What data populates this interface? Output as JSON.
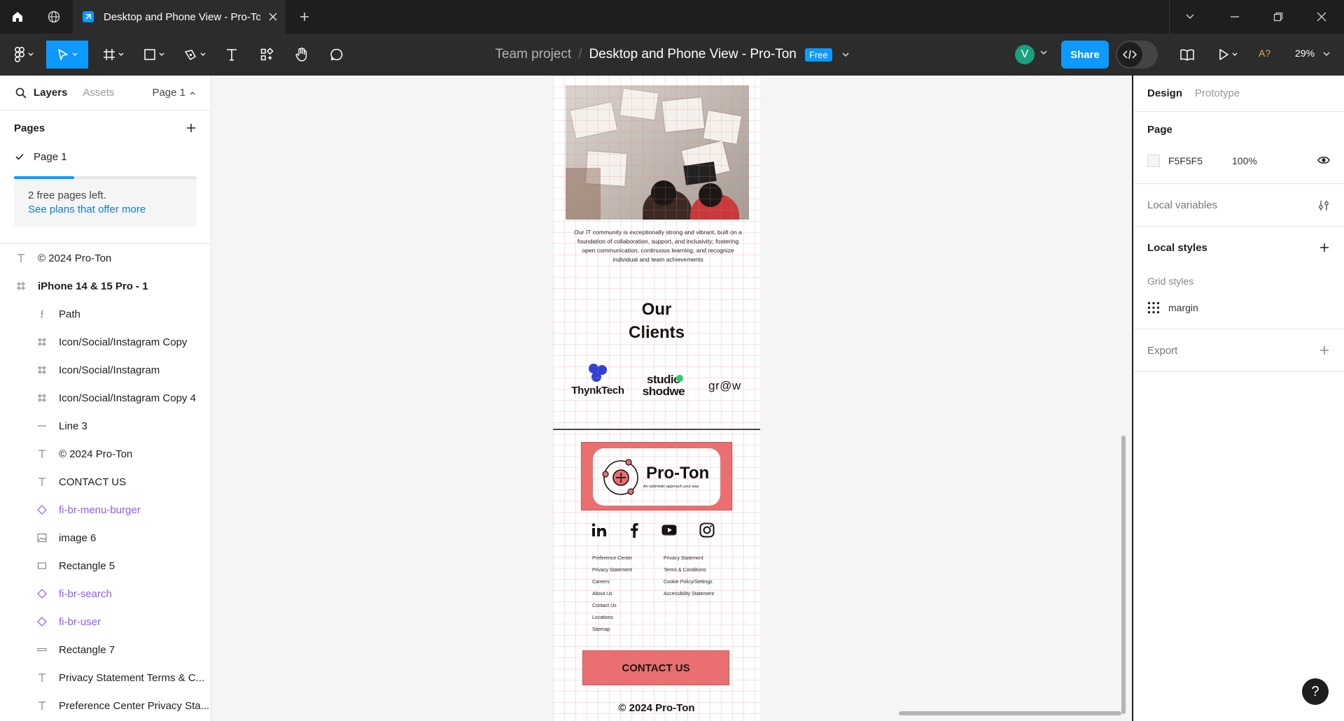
{
  "browser": {
    "tab_title": "Desktop and Phone View - Pro-Ton"
  },
  "toolbar": {
    "breadcrumb_team": "Team project",
    "breadcrumb_separator": "/",
    "file_name": "Desktop and Phone View - Pro-Ton",
    "plan_badge": "Free",
    "avatar_initial": "V",
    "share_label": "Share",
    "ai_label": "A?",
    "zoom": "29%"
  },
  "left_panel": {
    "tabs": {
      "layers": "Layers",
      "assets": "Assets",
      "page": "Page 1"
    },
    "pages_title": "Pages",
    "pages": [
      {
        "label": "Page 1",
        "selected": true
      }
    ],
    "quota_fraction": 0.33,
    "quota_text": "2 free pages left.",
    "quota_link": "See plans that offer more",
    "layers": [
      {
        "label": "© 2024 Pro-Ton",
        "icon": "text-icon",
        "level": 0,
        "bold": false,
        "component": false
      },
      {
        "label": "iPhone 14 & 15 Pro - 1",
        "icon": "frame-icon",
        "level": 0,
        "bold": true,
        "component": false
      },
      {
        "label": "Path",
        "icon": "path-icon",
        "level": 1,
        "bold": false,
        "component": false
      },
      {
        "label": "Icon/Social/Instagram Copy",
        "icon": "frame-icon",
        "level": 1,
        "bold": false,
        "component": false
      },
      {
        "label": "Icon/Social/Instagram",
        "icon": "frame-icon",
        "level": 1,
        "bold": false,
        "component": false
      },
      {
        "label": "Icon/Social/Instagram Copy 4",
        "icon": "frame-icon",
        "level": 1,
        "bold": false,
        "component": false
      },
      {
        "label": "Line 3",
        "icon": "line-icon",
        "level": 1,
        "bold": false,
        "component": false
      },
      {
        "label": "© 2024 Pro-Ton",
        "icon": "text-icon",
        "level": 1,
        "bold": false,
        "component": false
      },
      {
        "label": "CONTACT US",
        "icon": "text-icon",
        "level": 1,
        "bold": false,
        "component": false
      },
      {
        "label": "fi-br-menu-burger",
        "icon": "component-instance-icon",
        "level": 1,
        "bold": false,
        "component": true
      },
      {
        "label": "image 6",
        "icon": "image-icon",
        "level": 1,
        "bold": false,
        "component": false
      },
      {
        "label": "Rectangle 5",
        "icon": "rectangle-icon",
        "level": 1,
        "bold": false,
        "component": false
      },
      {
        "label": "fi-br-search",
        "icon": "component-instance-icon",
        "level": 1,
        "bold": false,
        "component": true
      },
      {
        "label": "fi-br-user",
        "icon": "component-instance-icon",
        "level": 1,
        "bold": false,
        "component": true
      },
      {
        "label": "Rectangle 7",
        "icon": "rectangle-thin-icon",
        "level": 1,
        "bold": false,
        "component": false
      },
      {
        "label": "Privacy Statement Terms & C...",
        "icon": "text-icon",
        "level": 1,
        "bold": false,
        "component": false
      },
      {
        "label": "Preference Center Privacy Sta...",
        "icon": "text-icon",
        "level": 1,
        "bold": false,
        "component": false
      }
    ]
  },
  "canvas": {
    "about_text": "Our IT community is exceptionally strong and vibrant, built on a foundation of collaboration, support, and inclusivity; fostering open communication, continuous learning, and recognize individual and team achievements",
    "clients_title_line1": "Our",
    "clients_title_line2": "Clients",
    "clients": {
      "thynk": "ThynkTech",
      "studio_line1": "studio",
      "studio_line2": "shodwe",
      "grow": "gr@w"
    },
    "brand_name": "Pro-Ton",
    "brand_tagline": "An optimistic approach your way",
    "social_icons": [
      "linkedin-icon",
      "facebook-icon",
      "youtube-icon",
      "instagram-icon"
    ],
    "links_col1": [
      "Preference Center",
      "Privacy Statement",
      "Careers",
      "About Us",
      "Contact Us",
      "Locations",
      "Sitemap"
    ],
    "links_col2": [
      "Privacy Statement",
      "Terms & Conditions",
      "Cookie Policy/Settings",
      "Accessibility Statement"
    ],
    "contact_label": "CONTACT US",
    "copyright": "© 2024 Pro-Ton",
    "brand_color": "#e96f70"
  },
  "right_panel": {
    "tabs": {
      "design": "Design",
      "prototype": "Prototype"
    },
    "page_title": "Page",
    "page_color": "F5F5F5",
    "page_opacity": "100%",
    "local_variables": "Local variables",
    "local_styles": "Local styles",
    "grid_styles": "Grid styles",
    "grid_style_name": "margin",
    "export": "Export"
  },
  "help_label": "?"
}
